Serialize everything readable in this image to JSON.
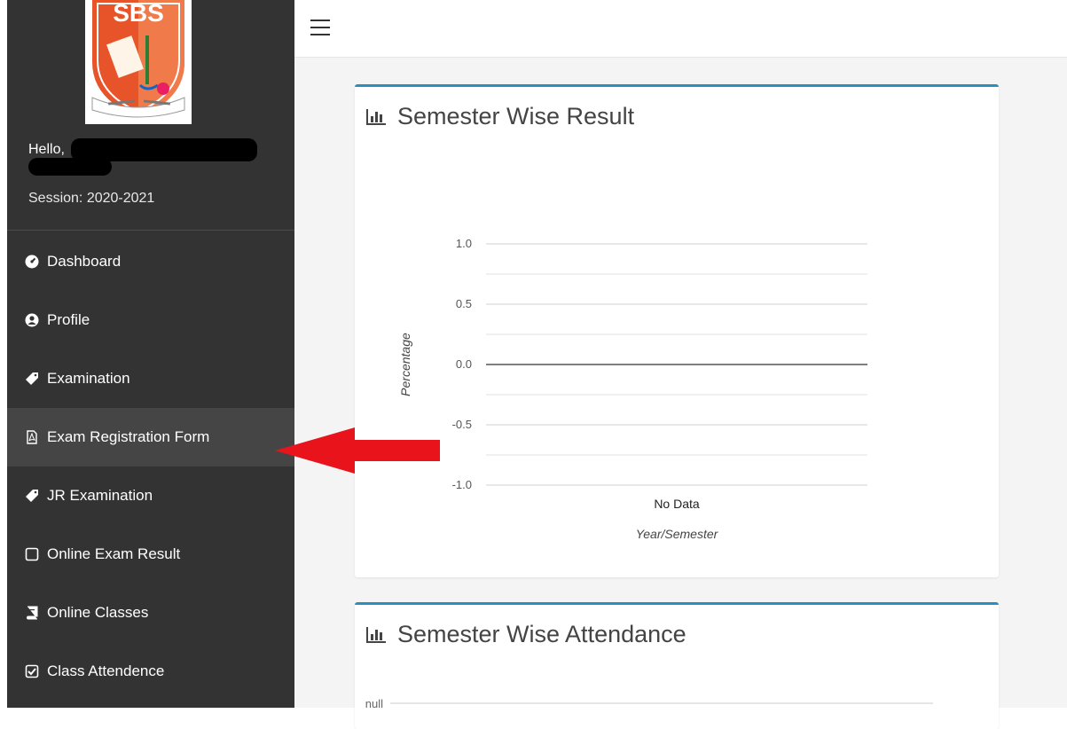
{
  "sidebar": {
    "logo": {
      "text": "SBS"
    },
    "greeting": "Hello,",
    "session": "Session: 2020-2021",
    "items": [
      {
        "label": "Dashboard",
        "icon": "dashboard-icon"
      },
      {
        "label": "Profile",
        "icon": "user-circle-icon"
      },
      {
        "label": "Examination",
        "icon": "tag-icon"
      },
      {
        "label": "Exam Registration Form",
        "icon": "pdf-file-icon",
        "active": true
      },
      {
        "label": "JR Examination",
        "icon": "tag-icon"
      },
      {
        "label": "Online Exam Result",
        "icon": "square-icon"
      },
      {
        "label": "Online Classes",
        "icon": "book-icon"
      },
      {
        "label": "Class Attendence",
        "icon": "check-square-icon"
      }
    ]
  },
  "topbar": {
    "menu_icon": "hamburger-icon"
  },
  "cards": [
    {
      "title": "Semester Wise Result",
      "icon": "bar-chart-icon"
    },
    {
      "title": "Semester Wise Attendance",
      "icon": "bar-chart-icon"
    }
  ],
  "chart_data": [
    {
      "type": "bar",
      "categories": [
        "No Data"
      ],
      "values": [],
      "xlabel": "Year/Semester",
      "ylabel": "Percentage",
      "ylim": [
        -1.0,
        1.0
      ],
      "yticks": [
        "1.0",
        "0.5",
        "0.0",
        "-0.5",
        "-1.0"
      ],
      "grid": true
    },
    {
      "type": "bar",
      "categories": [],
      "values": [],
      "yticks": [
        "null"
      ],
      "grid": true
    }
  ],
  "annotations": {
    "arrow_color": "#e8131b"
  },
  "colors": {
    "sidebar_bg": "#333333",
    "active_item_bg": "#454545",
    "card_border": "#2a8fbf",
    "content_bg": "#f4f4f4",
    "logo_orange": "#e8542a"
  }
}
